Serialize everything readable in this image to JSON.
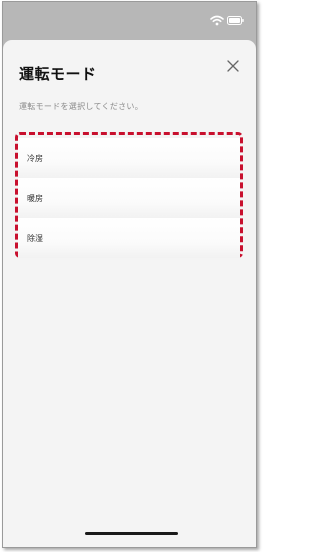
{
  "sheet": {
    "title": "運転モード",
    "instruction": "運転モードを選択してください。"
  },
  "modes": [
    {
      "label": "冷房"
    },
    {
      "label": "暖房"
    },
    {
      "label": "除湿"
    }
  ],
  "colors": {
    "highlight_border": "#c8102e",
    "sheet_background": "#f4f4f4",
    "backdrop": "#b7b7b7"
  },
  "icons": [
    "wifi-icon",
    "battery-icon",
    "close-icon"
  ]
}
